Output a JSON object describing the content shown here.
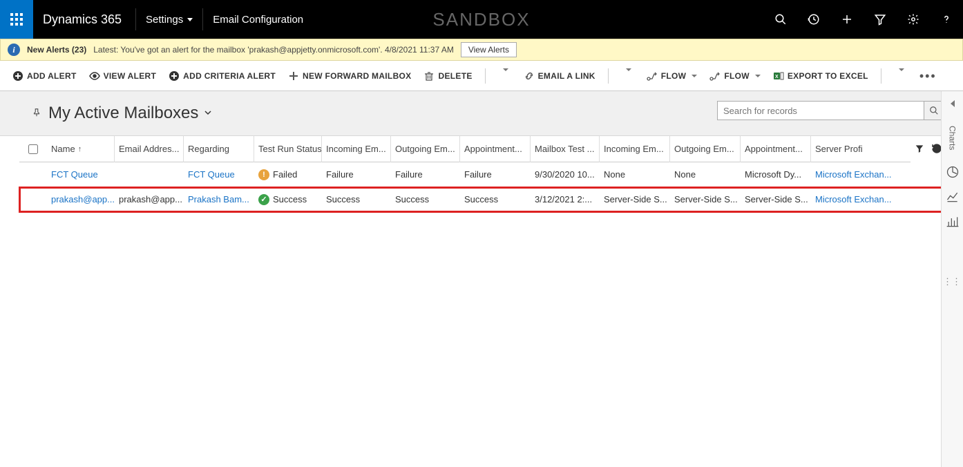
{
  "topbar": {
    "brand": "Dynamics 365",
    "nav_settings": "Settings",
    "nav_email_config": "Email Configuration",
    "sandbox": "SANDBOX"
  },
  "alertbar": {
    "title": "New Alerts (23)",
    "latest": "Latest: You've got an alert for the mailbox 'prakash@appjetty.onmicrosoft.com'. 4/8/2021 11:37 AM",
    "view_alerts": "View Alerts"
  },
  "commands": {
    "add_alert": "ADD ALERT",
    "view_alert": "VIEW ALERT",
    "add_criteria": "ADD CRITERIA ALERT",
    "new_forward": "NEW FORWARD MAILBOX",
    "delete": "DELETE",
    "email_link": "EMAIL A LINK",
    "flow1": "FLOW",
    "flow2": "FLOW",
    "export_excel": "EXPORT TO EXCEL"
  },
  "view": {
    "title": "My Active Mailboxes",
    "search_placeholder": "Search for records"
  },
  "columns": {
    "name": "Name",
    "email": "Email Addres...",
    "regarding": "Regarding",
    "testrun": "Test Run Status",
    "incoming": "Incoming Em...",
    "outgoing": "Outgoing Em...",
    "appt": "Appointment...",
    "mbtest": "Mailbox Test ...",
    "incoming2": "Incoming Em...",
    "outgoing2": "Outgoing Em...",
    "appt2": "Appointment...",
    "server": "Server Profi"
  },
  "rows": [
    {
      "name": "FCT Queue",
      "email": "",
      "regarding": "FCT Queue",
      "status_icon": "warn",
      "testrun": "Failed",
      "incoming": "Failure",
      "outgoing": "Failure",
      "appt": "Failure",
      "mbtest": "9/30/2020 10...",
      "incoming2": "None",
      "outgoing2": "None",
      "appt2": "Microsoft Dy...",
      "server": "Microsoft Exchan..."
    },
    {
      "name": "prakash@app...",
      "email": "prakash@app...",
      "regarding": "Prakash Bam...",
      "status_icon": "ok",
      "testrun": "Success",
      "incoming": "Success",
      "outgoing": "Success",
      "appt": "Success",
      "mbtest": "3/12/2021 2:...",
      "incoming2": "Server-Side S...",
      "outgoing2": "Server-Side S...",
      "appt2": "Server-Side S...",
      "server": "Microsoft Exchan..."
    }
  ],
  "side": {
    "charts": "Charts"
  }
}
